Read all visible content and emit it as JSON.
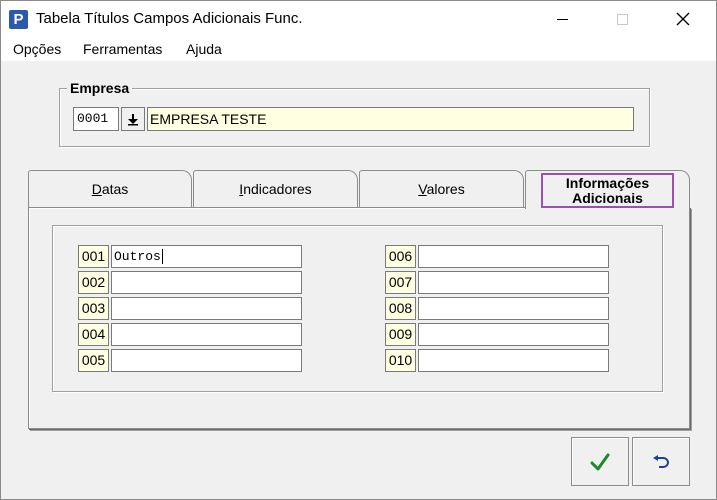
{
  "window": {
    "title": "Tabela Títulos Campos Adicionais Func.",
    "app_icon_letter": "P"
  },
  "menu": {
    "items": [
      "Opções",
      "Ferramentas",
      "Ajuda"
    ]
  },
  "empresa": {
    "label": "Empresa",
    "code": "0001",
    "name": "EMPRESA TESTE"
  },
  "tabs": [
    {
      "label": "Datas",
      "underline_letter": "D",
      "rest": "atas"
    },
    {
      "label": "Indicadores",
      "underline_letter": "I",
      "rest": "ndicadores"
    },
    {
      "label": "Valores",
      "underline_letter": "V",
      "rest": "alores"
    },
    {
      "label_line1": "Informações",
      "label_line2": "Adicionais",
      "active": true
    }
  ],
  "fields_left": [
    {
      "num": "001",
      "value": "Outros"
    },
    {
      "num": "002",
      "value": ""
    },
    {
      "num": "003",
      "value": ""
    },
    {
      "num": "004",
      "value": ""
    },
    {
      "num": "005",
      "value": ""
    }
  ],
  "fields_right": [
    {
      "num": "006",
      "value": ""
    },
    {
      "num": "007",
      "value": ""
    },
    {
      "num": "008",
      "value": ""
    },
    {
      "num": "009",
      "value": ""
    },
    {
      "num": "010",
      "value": ""
    }
  ],
  "icons": {
    "app": "app-logo-icon",
    "lookup": "download-arrow-icon",
    "confirm": "checkmark-icon",
    "undo": "undo-icon"
  },
  "colors": {
    "highlight_field": "#ffffe1",
    "active_tab_outline": "#9b4fb0",
    "confirm_check": "#1a8a2a",
    "undo_arrow": "#1f3f9a"
  }
}
